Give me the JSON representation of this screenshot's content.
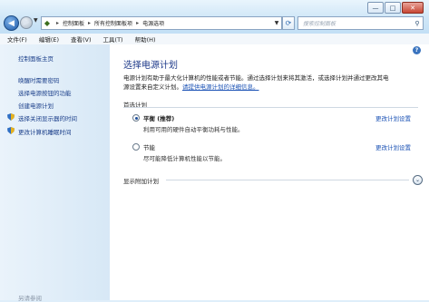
{
  "window": {
    "minimize": "—",
    "maximize": "□",
    "close": "✕"
  },
  "address": {
    "crumbs": [
      "控制面板",
      "所有控制面板项",
      "电源选项"
    ]
  },
  "search": {
    "placeholder": "搜索控制面板"
  },
  "menu": [
    "文件(F)",
    "编辑(E)",
    "查看(V)",
    "工具(T)",
    "帮助(H)"
  ],
  "sidebar": {
    "home": "控制面板主页",
    "links": [
      "唤醒时需要密码",
      "选择电源按钮的功能",
      "创建电源计划",
      "选择关闭显示器的时间",
      "更改计算机睡眠时间"
    ],
    "see_also": "另请参阅"
  },
  "main": {
    "title": "选择电源计划",
    "desc_line1": "电源计划有助于最大化计算机的性能或者节能。通过选择计划来将其激活，或选择计划并通过更改其电",
    "desc_line2_prefix": "源设置来自定义计划。",
    "desc_link": "请提供电源计划的详细信息。",
    "preferred_label": "首选计划",
    "plans": [
      {
        "name": "平衡 (推荐)",
        "desc": "利用可用的硬件自动平衡功耗与性能。",
        "link": "更改计划设置",
        "selected": true
      },
      {
        "name": "节能",
        "desc": "尽可能降低计算机性能以节能。",
        "link": "更改计划设置",
        "selected": false
      }
    ],
    "additional_label": "显示附加计划"
  }
}
